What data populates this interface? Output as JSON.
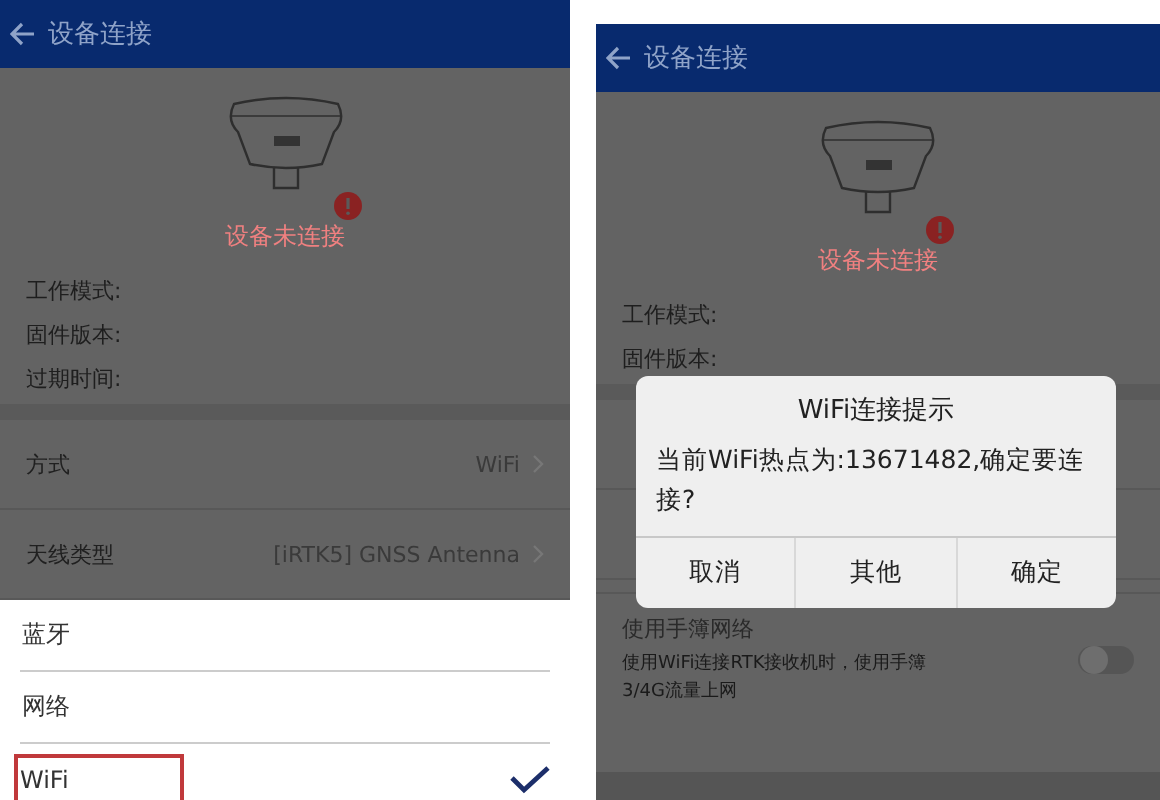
{
  "screens": [
    {
      "header": {
        "title": "设备连接"
      },
      "status": "设备未连接",
      "info_labels": [
        "工作模式:",
        "固件版本:",
        "过期时间:"
      ],
      "settings": [
        {
          "label": "方式",
          "value": "WiFi"
        },
        {
          "label": "天线类型",
          "value": "[iRTK5] GNSS Antenna"
        }
      ],
      "sheet_options": [
        {
          "label": "蓝牙",
          "selected": false
        },
        {
          "label": "网络",
          "selected": false
        },
        {
          "label": "WiFi",
          "selected": true
        }
      ]
    },
    {
      "header": {
        "title": "设备连接"
      },
      "status": "设备未连接",
      "info_labels": [
        "工作模式:",
        "固件版本:"
      ],
      "network_option": {
        "title": "使用手簿网络",
        "description": "使用WiFi连接RTK接收机时，使用手簿3/4G流量上网",
        "on": false
      },
      "dialog": {
        "title": "WiFi连接提示",
        "message": "当前WiFi热点为:13671482,确定要连接?",
        "buttons": [
          "取消",
          "其他",
          "确定"
        ]
      }
    }
  ]
}
